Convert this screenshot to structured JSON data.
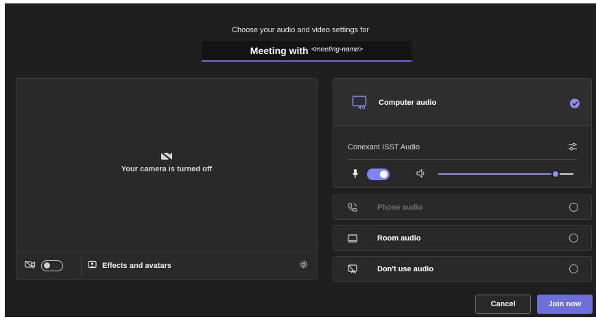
{
  "header": {
    "subtitle": "Choose your audio and video settings for",
    "title_main": "Meeting with",
    "title_meeting_name": "<meeting-name>"
  },
  "video": {
    "camera_status": "Your camera is turned off",
    "camera_toggle_on": false,
    "effects_label": "Effects and avatars"
  },
  "audio": {
    "computer_audio_label": "Computer audio",
    "computer_audio_selected": true,
    "device_name": "Conexant ISST Audio",
    "mic_toggle_on": true,
    "volume_level": 0.87,
    "options": [
      {
        "label": "Phone audio",
        "disabled": true,
        "selected": false,
        "icon": "phone-audio-icon"
      },
      {
        "label": "Room audio",
        "disabled": false,
        "selected": false,
        "icon": "room-audio-icon"
      },
      {
        "label": "Don't use audio",
        "disabled": false,
        "selected": false,
        "icon": "no-audio-icon"
      }
    ]
  },
  "actions": {
    "cancel_label": "Cancel",
    "join_label": "Join now"
  },
  "colors": {
    "accent": "#7f85f5",
    "join_button": "#6c70d8",
    "background": "#1f1f1f",
    "panel": "#292929"
  }
}
